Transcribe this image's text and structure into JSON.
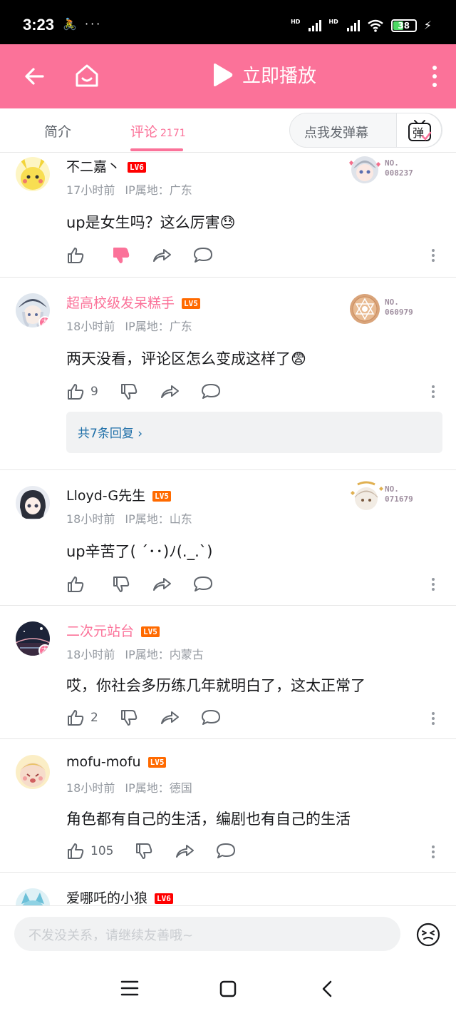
{
  "status_bar": {
    "time": "3:23",
    "notification_icons": "🚴 ···",
    "network_label_1": "HD",
    "network_label_2": "HD",
    "battery": "38"
  },
  "header": {
    "play_label": "立即播放",
    "accent_color": "#fb7299"
  },
  "tabs": {
    "intro_label": "简介",
    "comments_label": "评论",
    "comments_count": "2171",
    "danmaku_placeholder": "点我发弹幕",
    "danmaku_button": "弹"
  },
  "comments": [
    {
      "username": "不二嘉丶",
      "level": "LV6",
      "time": "17小时前",
      "ip": "IP属地：广东",
      "content": "up是女生吗？这么厉害😓",
      "like_count": "",
      "fan_no_label": "NO.",
      "fan_no_value": "008237"
    },
    {
      "username": "超高校级发呆糕手",
      "level": "LV5",
      "time": "18小时前",
      "ip": "IP属地：广东",
      "content": "两天没看，评论区怎么变成这样了😨",
      "like_count": "9",
      "fan_no_label": "NO.",
      "fan_no_value": "060979",
      "replies_label": "共7条回复 ›"
    },
    {
      "username": "Lloyd-G先生",
      "level": "LV5",
      "time": "18小时前",
      "ip": "IP属地：山东",
      "content": "up辛苦了( ´･･)ﾉ(._.`)",
      "like_count": "",
      "fan_no_label": "NO.",
      "fan_no_value": "071679"
    },
    {
      "username": "二次元站台",
      "level": "LV5",
      "time": "18小时前",
      "ip": "IP属地：内蒙古",
      "content": "哎，你社会多历练几年就明白了，这太正常了",
      "like_count": "2"
    },
    {
      "username": "mofu-mofu",
      "level": "LV5",
      "time": "18小时前",
      "ip": "IP属地：德国",
      "content": "角色都有自己的生活，编剧也有自己的生活",
      "like_count": "105"
    },
    {
      "username": "爱哪吒的小狼",
      "level": "LV6"
    }
  ],
  "input_bar": {
    "placeholder": "不发没关系，请继续友善哦~"
  }
}
